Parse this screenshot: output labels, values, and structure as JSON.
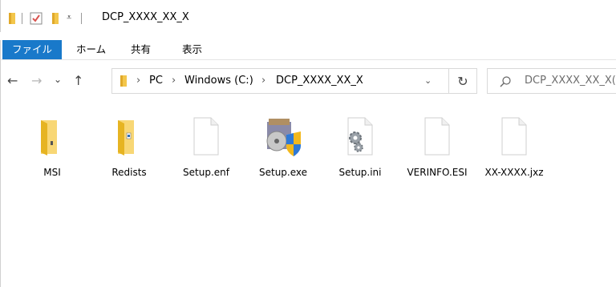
{
  "window": {
    "title": "DCP_XXXX_XX_X"
  },
  "ribbon": {
    "tabs": [
      "ファイル",
      "ホーム",
      "共有",
      "表示"
    ]
  },
  "nav": {
    "back": "←",
    "forward": "→",
    "recent": "⌄",
    "up": "↑",
    "dropdown": "⌄",
    "refresh": "↻"
  },
  "address": {
    "crumbs": [
      "PC",
      "Windows (C:)",
      "DCP_XXXX_XX_X"
    ],
    "separator": "›"
  },
  "search": {
    "placeholder": "DCP_XXXX_XX_X の検索",
    "visible_text": "DCP_XXXX_XX_X("
  },
  "files": [
    {
      "name": "MSI",
      "icon": "folder-icon"
    },
    {
      "name": "Redists",
      "icon": "folder-icon"
    },
    {
      "name": "Setup.enf",
      "icon": "file-icon"
    },
    {
      "name": "Setup.exe",
      "icon": "installer-icon"
    },
    {
      "name": "Setup.ini",
      "icon": "settings-file-icon"
    },
    {
      "name": "VERINFO.ESI",
      "icon": "file-icon"
    },
    {
      "name": "XX-XXXX.jxz",
      "icon": "file-icon"
    }
  ],
  "colors": {
    "accent": "#1979ca",
    "folder": "#f8d775"
  }
}
